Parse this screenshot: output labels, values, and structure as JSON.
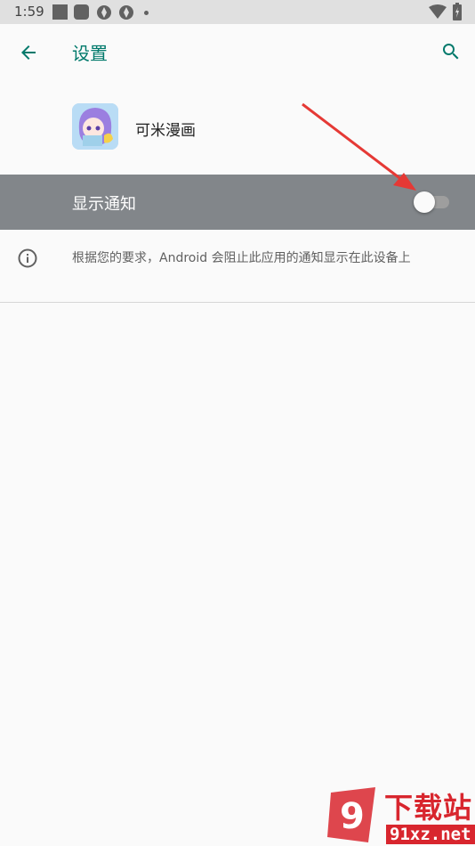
{
  "status_bar": {
    "time": "1:59"
  },
  "app_bar": {
    "title": "设置"
  },
  "app": {
    "name": "可米漫画"
  },
  "notification_setting": {
    "label": "显示通知",
    "enabled": false
  },
  "info": {
    "text": "根据您的要求，Android 会阻止此应用的通知显示在此设备上"
  },
  "watermark": {
    "top": "下载站",
    "bottom": "91xz.net",
    "badge": "9"
  },
  "colors": {
    "accent": "#00796b",
    "highlight_row": "#82868a",
    "annotation_arrow": "#e53935",
    "watermark": "#d8262e"
  }
}
